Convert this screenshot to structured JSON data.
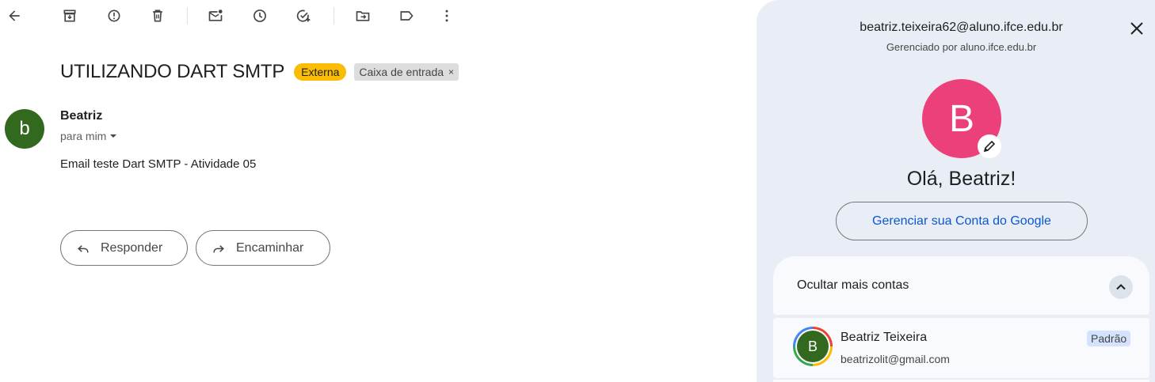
{
  "toolbar": {
    "icons": [
      "back-icon",
      "archive-icon",
      "report-spam-icon",
      "delete-icon",
      "mark-unread-icon",
      "snooze-icon",
      "add-task-icon",
      "move-to-icon",
      "label-icon",
      "more-vert-icon"
    ]
  },
  "email": {
    "subject": "UTILIZANDO DART SMTP",
    "labels": {
      "external": "Externa",
      "inbox": "Caixa de entrada",
      "inbox_remove": "×"
    },
    "sender": {
      "initial": "b",
      "name": "Beatriz",
      "to": "para mim"
    },
    "body": "Email teste Dart SMTP - Atividade 05",
    "actions": {
      "reply": "Responder",
      "forward": "Encaminhar"
    }
  },
  "account_panel": {
    "email": "beatriz.teixeira62@aluno.ifce.edu.br",
    "managed_by": "Gerenciado por aluno.ifce.edu.br",
    "avatar_initial": "B",
    "greeting": "Olá, Beatriz!",
    "manage_button": "Gerenciar sua Conta do Google",
    "more_accounts_label": "Ocultar mais contas",
    "accounts": [
      {
        "initial": "B",
        "name": "Beatriz Teixeira",
        "email": "beatrizolit@gmail.com",
        "badge": "Padrão"
      }
    ]
  },
  "colors": {
    "external_label": "#fbbc04",
    "sender_avatar": "#33691e",
    "account_avatar": "#ec407a",
    "link_blue": "#0b57d0",
    "panel_bg": "#e9eef6"
  }
}
